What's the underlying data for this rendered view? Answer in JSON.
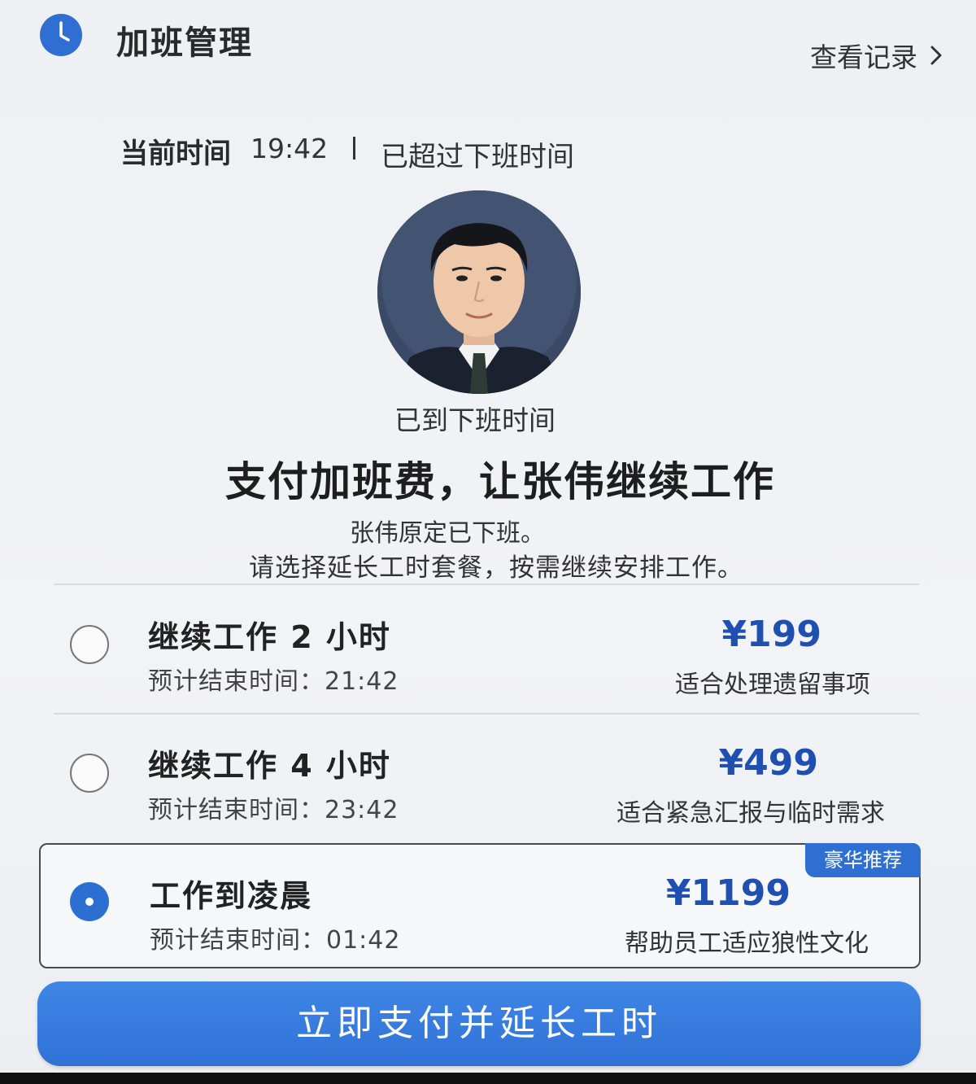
{
  "header": {
    "title": "加班管理",
    "view_records": "查看记录"
  },
  "status": {
    "label": "当前时间",
    "time": "19:42",
    "message": "已超过下班时间"
  },
  "profile": {
    "off_work_text": "已到下班时间",
    "headline": "支付加班费，让张伟继续工作",
    "desc_line1": "张伟原定已下班。",
    "desc_line2": "请选择延长工时套餐，按需继续安排工作。"
  },
  "options": [
    {
      "title": "继续工作 2 小时",
      "end_time": "预计结束时间：21:42",
      "price": "¥199",
      "note": "适合处理遗留事项",
      "selected": false
    },
    {
      "title": "继续工作 4 小时",
      "end_time": "预计结束时间：23:42",
      "price": "¥499",
      "note": "适合紧急汇报与临时需求",
      "selected": false
    },
    {
      "title": "工作到凌晨",
      "end_time": "预计结束时间：01:42",
      "price": "¥1199",
      "note": "帮助员工适应狼性文化",
      "badge": "豪华推荐",
      "selected": true
    }
  ],
  "pay_button": "立即支付并延长工时",
  "colors": {
    "accent": "#2f6fd2",
    "price": "#1f4fb0",
    "moon": "#f0a050"
  }
}
